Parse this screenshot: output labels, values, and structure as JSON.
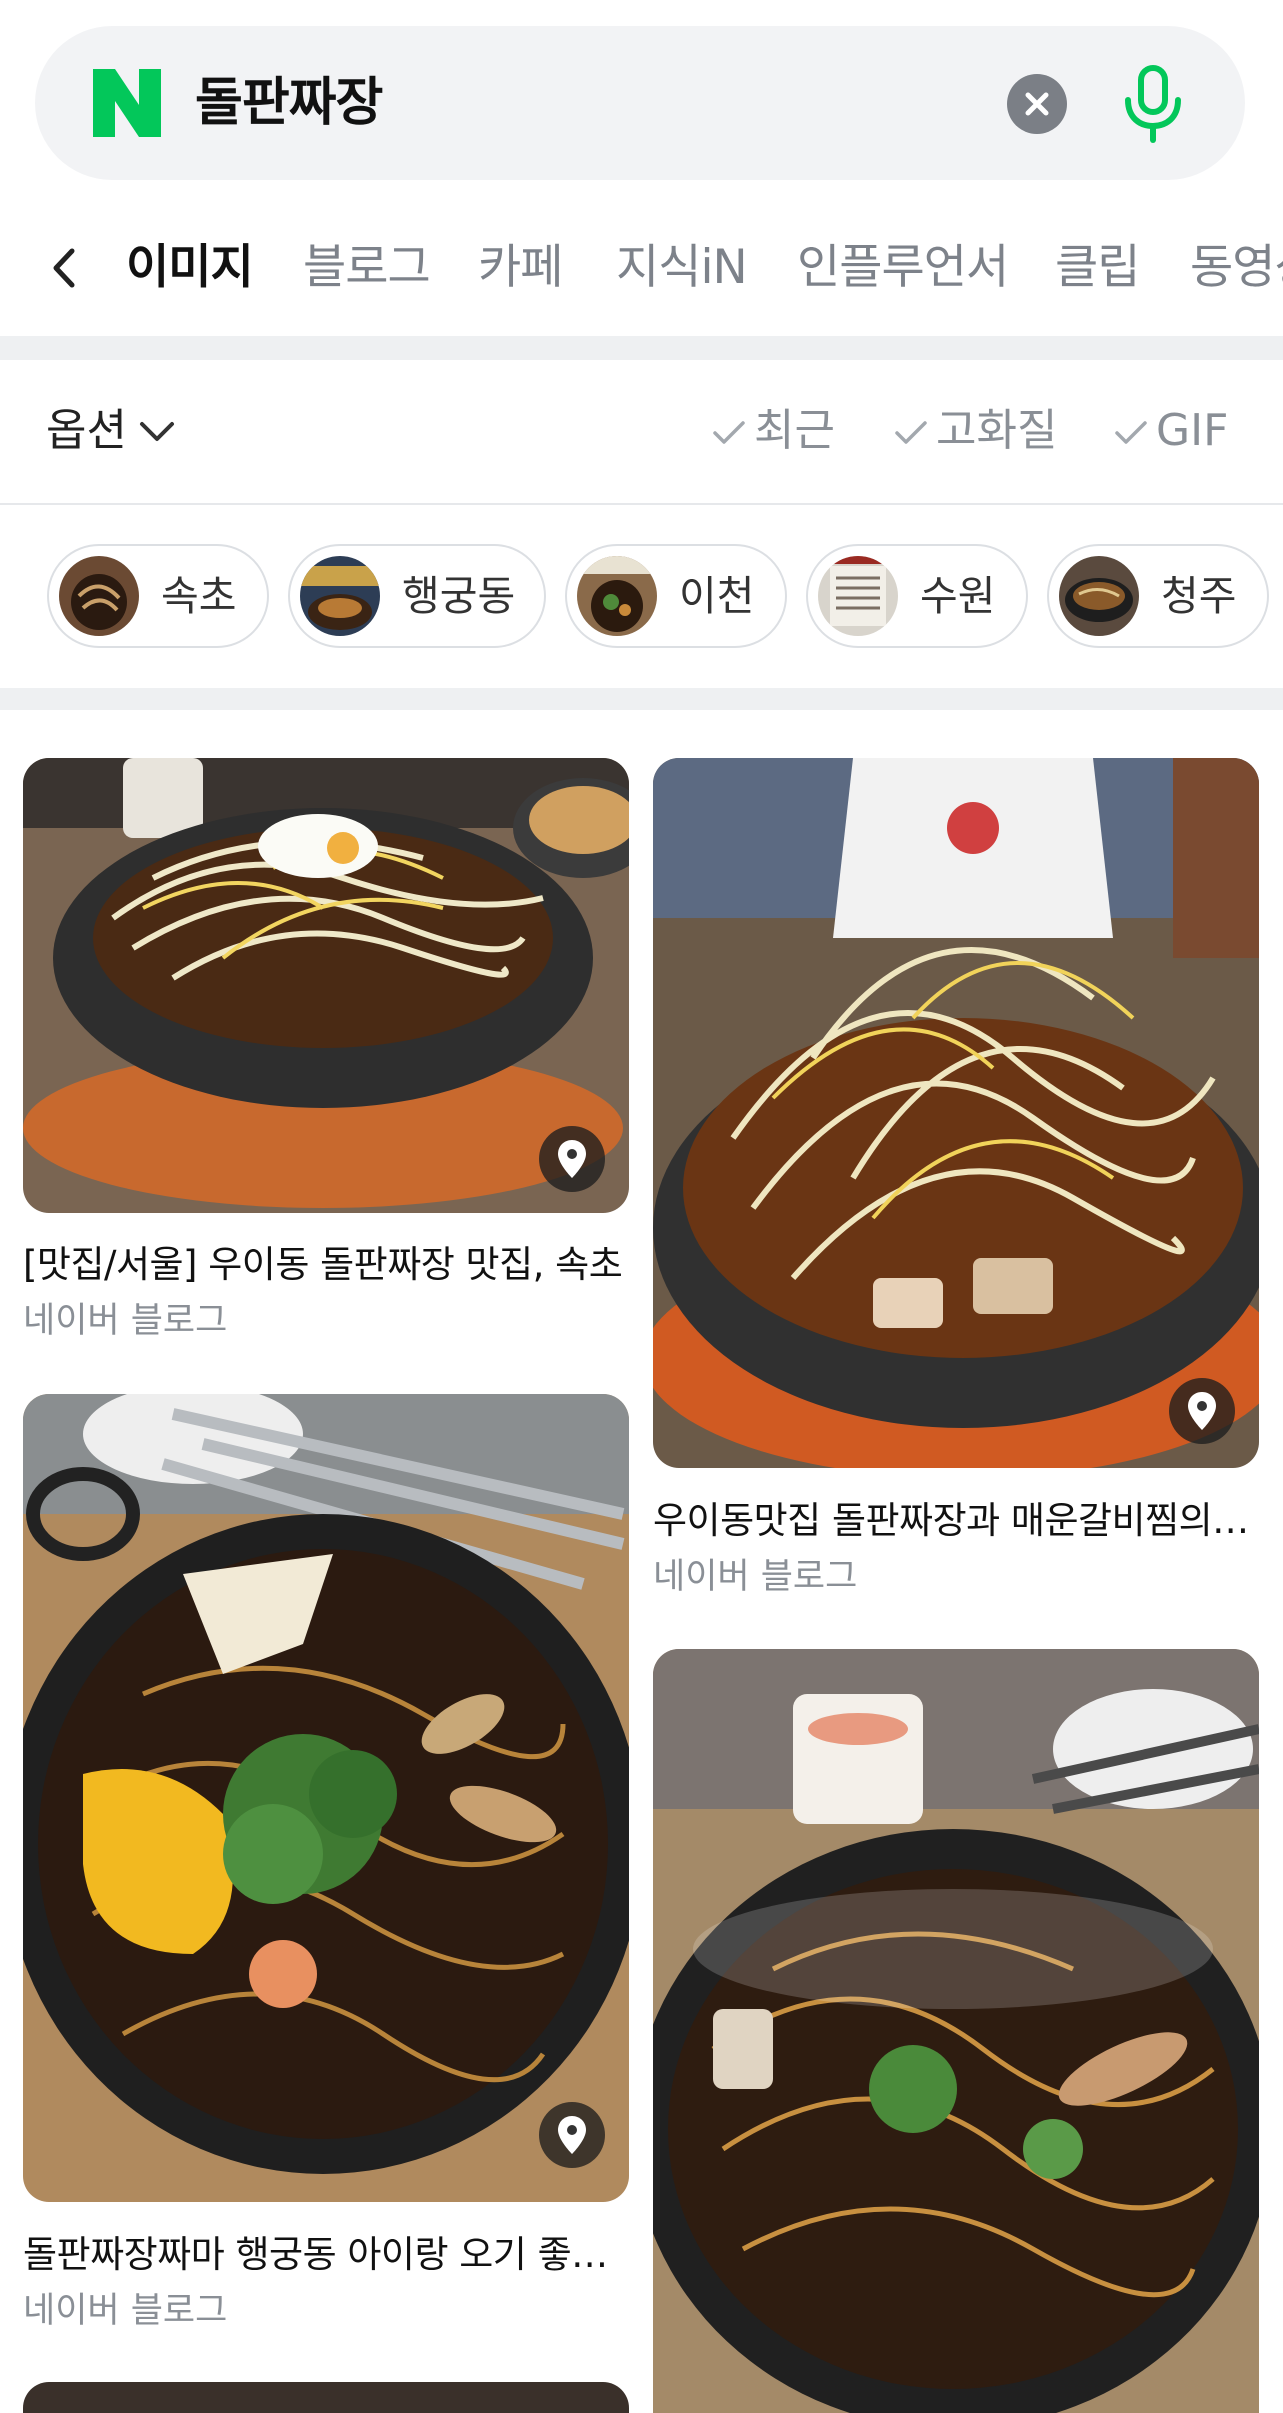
{
  "search": {
    "query": "돌판짜장",
    "brand_color": "#03c75a"
  },
  "tabs": [
    "이미지",
    "블로그",
    "카페",
    "지식iN",
    "인플루언서",
    "클립",
    "동영상"
  ],
  "active_tab": "이미지",
  "options": {
    "label": "옵션",
    "filters": [
      "최근",
      "고화질",
      "GIF"
    ]
  },
  "chips": [
    "속초",
    "행궁동",
    "이천",
    "수원",
    "청주"
  ],
  "results": [
    {
      "title": "[맛집/서울] 우이동 돌판짜장 맛집, 속초",
      "source": "네이버 블로그"
    },
    {
      "title": "우이동맛집 돌판짜장과 매운갈비찜의 맛집",
      "source": "네이버 블로그"
    },
    {
      "title": "돌판짜장짜마 행궁동 아이랑 오기 좋은 맛집",
      "source": "네이버 블로그"
    },
    {
      "title": "",
      "source": ""
    }
  ],
  "icons": {
    "logo": "naver-logo-icon",
    "clear": "close-circle-icon",
    "mic": "microphone-icon",
    "back": "chevron-left-icon",
    "options": "chevron-down-icon",
    "filter": "check-icon",
    "place": "location-pin-icon"
  }
}
